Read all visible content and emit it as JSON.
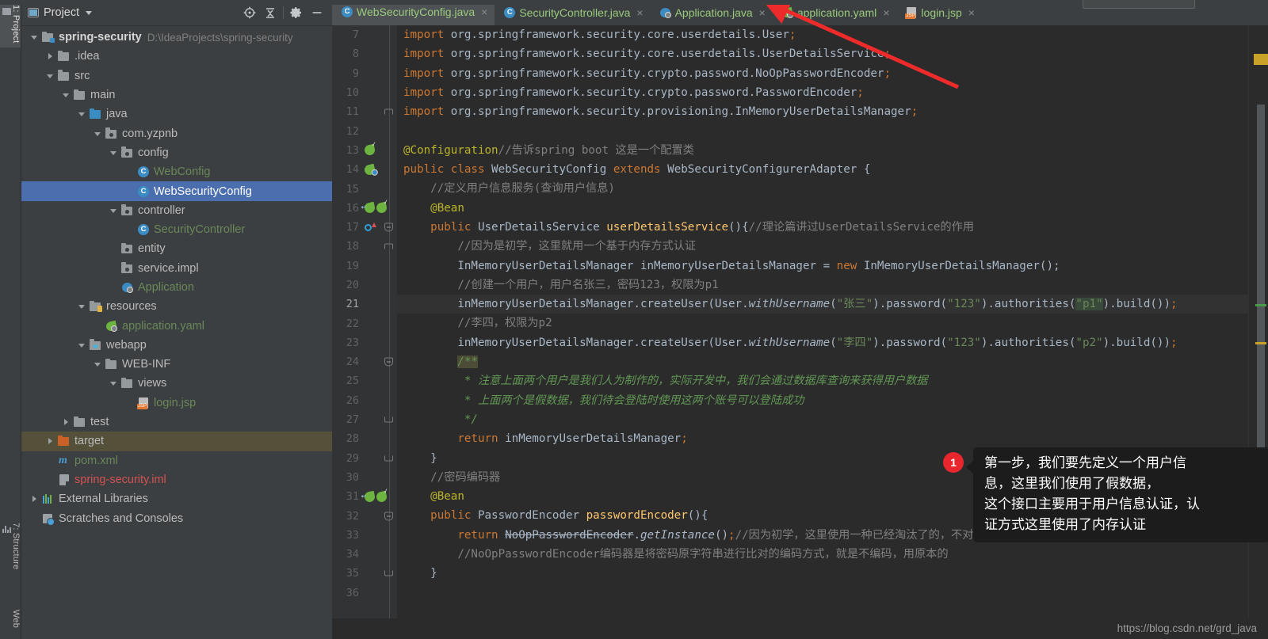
{
  "window": {
    "watermark": "https://blog.csdn.net/grd_java"
  },
  "left_strip": {
    "tabs": [
      {
        "label": "1: Project",
        "icon": "folder-icon",
        "active": true
      },
      {
        "label": "7: Structure",
        "icon": "structure-icon",
        "active": false
      },
      {
        "label": "Web",
        "icon": "web-icon",
        "active": false
      }
    ]
  },
  "project_panel": {
    "title": "Project",
    "toolbar": {
      "locate_label": "locate-icon",
      "collapse_label": "collapse-all-icon",
      "settings_label": "gear-icon",
      "hide_label": "minimize-icon"
    },
    "tree": [
      {
        "indent": 0,
        "arrow": "down",
        "icon": "module-folder",
        "label": "spring-security",
        "path": "D:\\IdeaProjects\\spring-security",
        "style": "bold"
      },
      {
        "indent": 1,
        "arrow": "right",
        "icon": "folder-gray",
        "label": ".idea",
        "path": ""
      },
      {
        "indent": 1,
        "arrow": "down",
        "icon": "folder-gray",
        "label": "src",
        "path": ""
      },
      {
        "indent": 2,
        "arrow": "down",
        "icon": "folder-gray",
        "label": "main",
        "path": ""
      },
      {
        "indent": 3,
        "arrow": "down",
        "icon": "folder-blue",
        "label": "java",
        "path": ""
      },
      {
        "indent": 4,
        "arrow": "down",
        "icon": "package",
        "label": "com.yzpnb",
        "path": ""
      },
      {
        "indent": 5,
        "arrow": "down",
        "icon": "package",
        "label": "config",
        "path": ""
      },
      {
        "indent": 6,
        "arrow": "none",
        "icon": "java-class",
        "label": "WebConfig",
        "path": "",
        "style": "green"
      },
      {
        "indent": 6,
        "arrow": "none",
        "icon": "java-class",
        "label": "WebSecurityConfig",
        "path": "",
        "selected": true
      },
      {
        "indent": 5,
        "arrow": "down",
        "icon": "package",
        "label": "controller",
        "path": ""
      },
      {
        "indent": 6,
        "arrow": "none",
        "icon": "java-class",
        "label": "SecurityController",
        "path": "",
        "style": "green"
      },
      {
        "indent": 5,
        "arrow": "none",
        "icon": "package",
        "label": "entity",
        "path": ""
      },
      {
        "indent": 5,
        "arrow": "none",
        "icon": "package",
        "label": "service.impl",
        "path": ""
      },
      {
        "indent": 5,
        "arrow": "none",
        "icon": "spring-boot",
        "label": "Application",
        "path": "",
        "style": "green"
      },
      {
        "indent": 3,
        "arrow": "down",
        "icon": "resources-folder",
        "label": "resources",
        "path": ""
      },
      {
        "indent": 4,
        "arrow": "none",
        "icon": "spring-yaml",
        "label": "application.yaml",
        "path": "",
        "style": "green"
      },
      {
        "indent": 3,
        "arrow": "down",
        "icon": "webapp-folder",
        "label": "webapp",
        "path": ""
      },
      {
        "indent": 4,
        "arrow": "down",
        "icon": "folder-gray",
        "label": "WEB-INF",
        "path": ""
      },
      {
        "indent": 5,
        "arrow": "down",
        "icon": "folder-gray",
        "label": "views",
        "path": ""
      },
      {
        "indent": 6,
        "arrow": "none",
        "icon": "jsp-file",
        "label": "login.jsp",
        "path": "",
        "style": "green"
      },
      {
        "indent": 2,
        "arrow": "right",
        "icon": "folder-gray",
        "label": "test",
        "path": ""
      },
      {
        "indent": 1,
        "arrow": "right",
        "icon": "folder-orange",
        "label": "target",
        "path": "",
        "highlight": true
      },
      {
        "indent": 1,
        "arrow": "none",
        "icon": "maven-file",
        "label": "pom.xml",
        "path": "",
        "style": "green"
      },
      {
        "indent": 1,
        "arrow": "none",
        "icon": "iml-file",
        "label": "spring-security.iml",
        "path": "",
        "style": "red"
      },
      {
        "indent": 0,
        "arrow": "right",
        "icon": "libraries",
        "label": "External Libraries",
        "path": ""
      },
      {
        "indent": 0,
        "arrow": "none",
        "icon": "scratches",
        "label": "Scratches and Consoles",
        "path": ""
      }
    ]
  },
  "editor": {
    "tabs": [
      {
        "label": "WebSecurityConfig.java",
        "icon": "java-class-icon",
        "active": true,
        "close": "×"
      },
      {
        "label": "SecurityController.java",
        "icon": "java-class-icon",
        "active": false,
        "close": "×"
      },
      {
        "label": "Application.java",
        "icon": "spring-boot-icon",
        "active": false,
        "close": "×"
      },
      {
        "label": "application.yaml",
        "icon": "spring-leaf-icon",
        "active": false,
        "close": "×"
      },
      {
        "label": "login.jsp",
        "icon": "jsp-icon",
        "active": false,
        "close": "×"
      }
    ],
    "current_line": 21,
    "lines": [
      {
        "n": 7,
        "gutter_icons": [],
        "fold": "",
        "html": "<span class=\"kw\">import</span> org.springframework.security.core.userdetails.User<span class=\"kw\">;</span>"
      },
      {
        "n": 8,
        "gutter_icons": [],
        "fold": "",
        "html": "<span class=\"kw\">import</span> org.springframework.security.core.userdetails.UserDetailsService<span class=\"kw\">;</span>"
      },
      {
        "n": 9,
        "gutter_icons": [],
        "fold": "",
        "html": "<span class=\"kw\">import</span> org.springframework.security.crypto.password.NoOpPasswordEncoder<span class=\"kw\">;</span>"
      },
      {
        "n": 10,
        "gutter_icons": [],
        "fold": "",
        "html": "<span class=\"kw\">import</span> org.springframework.security.crypto.password.PasswordEncoder<span class=\"kw\">;</span>"
      },
      {
        "n": 11,
        "gutter_icons": [],
        "fold": "topend",
        "html": "<span class=\"kw\">import</span> org.springframework.security.provisioning.InMemoryUserDetailsManager<span class=\"kw\">;</span>"
      },
      {
        "n": 12,
        "gutter_icons": [],
        "fold": "",
        "html": ""
      },
      {
        "n": 13,
        "gutter_icons": [
          "beanchk"
        ],
        "fold": "",
        "html": "<span class=\"ann\">@Configuration</span><span class=\"cmt\">//告诉spring boot 这是一个配置类</span>"
      },
      {
        "n": 14,
        "gutter_icons": [
          "beanblue"
        ],
        "fold": "",
        "html": "<span class=\"kw\">public</span> <span class=\"kw\">class</span> WebSecurityConfig <span class=\"kw\">extends</span> WebSecurityConfigurerAdapter {"
      },
      {
        "n": 15,
        "gutter_icons": [],
        "fold": "",
        "html": "    <span class=\"cmt\">//定义用户信息服务(查询用户信息)</span>"
      },
      {
        "n": 16,
        "gutter_icons": [
          "beanarrow",
          "beanchk"
        ],
        "fold": "",
        "html": "    <span class=\"ann\">@Bean</span>"
      },
      {
        "n": 17,
        "gutter_icons": [
          "override"
        ],
        "fold": "minus",
        "html": "    <span class=\"kw\">public</span> UserDetailsService <span class=\"fn\">userDetailsService</span>(){<span class=\"cmt\">//理论篇讲过UserDetailsService的作用</span>"
      },
      {
        "n": 18,
        "gutter_icons": [],
        "fold": "topend",
        "html": "        <span class=\"cmt\">//因为是初学，这里就用一个基于内存方式认证</span>"
      },
      {
        "n": 19,
        "gutter_icons": [],
        "fold": "",
        "html": "        InMemoryUserDetailsManager inMemoryUserDetailsManager = <span class=\"kw\">new</span> InMemoryUserDetailsManager();"
      },
      {
        "n": 20,
        "gutter_icons": [],
        "fold": "",
        "html": "        <span class=\"cmt\">//创建一个用户，用户名张三，密码123，权限为p1</span>"
      },
      {
        "n": 21,
        "gutter_icons": [],
        "fold": "",
        "current": true,
        "html": "        inMemoryUserDetailsManager.createUser(User.<span class=\"ital\">withUsername</span>(<span class=\"str\">\"张三\"</span>).password(<span class=\"str\">\"123\"</span>).authorities(<span class=\"str hl-p1\">\"p1\"</span>).build())<span class=\"kw\">;</span>"
      },
      {
        "n": 22,
        "gutter_icons": [],
        "fold": "",
        "html": "        <span class=\"cmt\">//李四，权限为p2</span>"
      },
      {
        "n": 23,
        "gutter_icons": [],
        "fold": "",
        "html": "        inMemoryUserDetailsManager.createUser(User.<span class=\"ital\">withUsername</span>(<span class=\"str\">\"李四\"</span>).password(<span class=\"str\">\"123\"</span>).authorities(<span class=\"str\">\"p2\"</span>).build())<span class=\"kw\">;</span>"
      },
      {
        "n": 24,
        "gutter_icons": [],
        "fold": "minus",
        "html": "        <span class=\"jdoc hl-doc\">/**</span>"
      },
      {
        "n": 25,
        "gutter_icons": [],
        "fold": "",
        "html": "         <span class=\"jdoc\">* 注意上面两个用户是我们人为制作的，实际开发中，我们会通过数据库查询来获得用户数据</span>"
      },
      {
        "n": 26,
        "gutter_icons": [],
        "fold": "",
        "html": "         <span class=\"jdoc\">* 上面两个是假数据，我们待会登陆时使用这两个账号可以登陆成功</span>"
      },
      {
        "n": 27,
        "gutter_icons": [],
        "fold": "botend",
        "html": "         <span class=\"jdoc\">*/</span>"
      },
      {
        "n": 28,
        "gutter_icons": [],
        "fold": "",
        "html": "        <span class=\"kw\">return</span> inMemoryUserDetailsManager<span class=\"kw\">;</span>"
      },
      {
        "n": 29,
        "gutter_icons": [],
        "fold": "botend",
        "html": "    }"
      },
      {
        "n": 30,
        "gutter_icons": [],
        "fold": "",
        "html": "    <span class=\"cmt\">//密码编码器</span>"
      },
      {
        "n": 31,
        "gutter_icons": [
          "beanarrow",
          "beanchk"
        ],
        "fold": "",
        "html": "    <span class=\"ann\">@Bean</span>"
      },
      {
        "n": 32,
        "gutter_icons": [],
        "fold": "minus",
        "html": "    <span class=\"kw\">public</span> PasswordEncoder <span class=\"fn\">passwordEncoder</span>(){"
      },
      {
        "n": 33,
        "gutter_icons": [],
        "fold": "",
        "html": "        <span class=\"kw\">return</span> <span class=\"strike\">NoOpPasswordEncoder</span>.<span class=\"ital\">getInstance</span>()<span class=\"kw\">;</span><span class=\"cmt\">//因为初学，这里使用一种已经淘汰了的，不对密码进行加密的编码器</span>"
      },
      {
        "n": 34,
        "gutter_icons": [],
        "fold": "",
        "html": "        <span class=\"cmt\">//NoOpPasswordEncoder编码器是将密码原字符串进行比对的编码方式，就是不编码，用原本的</span>"
      },
      {
        "n": 35,
        "gutter_icons": [],
        "fold": "botend",
        "html": "    }"
      },
      {
        "n": 36,
        "gutter_icons": [],
        "fold": "",
        "html": ""
      }
    ]
  },
  "annotation": {
    "badge": "1",
    "text": "第一步，我们要先定义一个用户信\n息，这里我们使用了假数据，\n这个接口主要用于用户信息认证，认\n证方式这里使用了内存认证",
    "arrow_color": "#ee2b2b"
  }
}
